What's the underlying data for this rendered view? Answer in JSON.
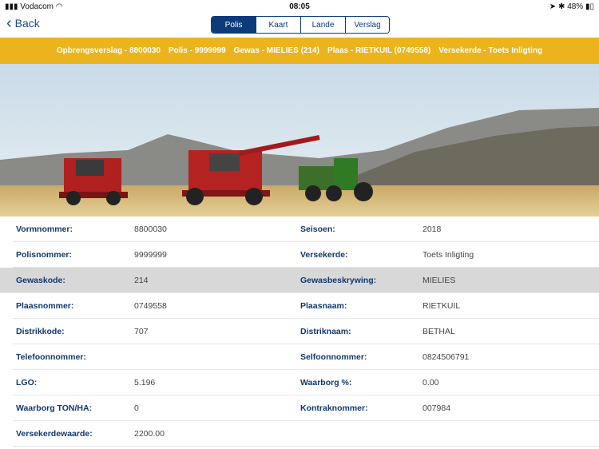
{
  "status": {
    "carrier": "Vodacom",
    "time": "08:05",
    "battery": "48%"
  },
  "nav": {
    "back": "Back",
    "tabs": [
      "Polis",
      "Kaart",
      "Lande",
      "Verslag"
    ],
    "active": "Polis"
  },
  "banner": [
    "Opbrengsverslag - 8800030",
    "Polis - 9999999",
    "Gewas - MIELIES (214)",
    "Plaas - RIETKUIL (0749558)",
    "Versekerde - Toets Inligting"
  ],
  "colors": {
    "accent": "#0d3b7a",
    "banner": "#ecb41c",
    "highlight": "#d8d8d8"
  },
  "rows": [
    {
      "l1": "Vormnommer:",
      "v1": "8800030",
      "l2": "Seisoen:",
      "v2": "2018"
    },
    {
      "l1": "Polisnommer:",
      "v1": "9999999",
      "l2": "Versekerde:",
      "v2": "Toets Inligting"
    },
    {
      "l1": "Gewaskode:",
      "v1": "214",
      "l2": "Gewasbeskrywing:",
      "v2": "MIELIES",
      "highlight": true
    },
    {
      "l1": "Plaasnommer:",
      "v1": "0749558",
      "l2": "Plaasnaam:",
      "v2": "RIETKUIL"
    },
    {
      "l1": "Distrikkode:",
      "v1": "707",
      "l2": "Distriknaam:",
      "v2": "BETHAL"
    },
    {
      "l1": "Telefoonnommer:",
      "v1": "",
      "l2": "Selfoonnommer:",
      "v2": "0824506791"
    },
    {
      "l1": "LGO:",
      "v1": "5.196",
      "l2": "Waarborg %:",
      "v2": "0.00"
    },
    {
      "l1": "Waarborg TON/HA:",
      "v1": "0",
      "l2": "Kontraknommer:",
      "v2": "007984"
    },
    {
      "l1": "Versekerdewaarde:",
      "v1": "2200.00",
      "l2": "",
      "v2": ""
    }
  ]
}
